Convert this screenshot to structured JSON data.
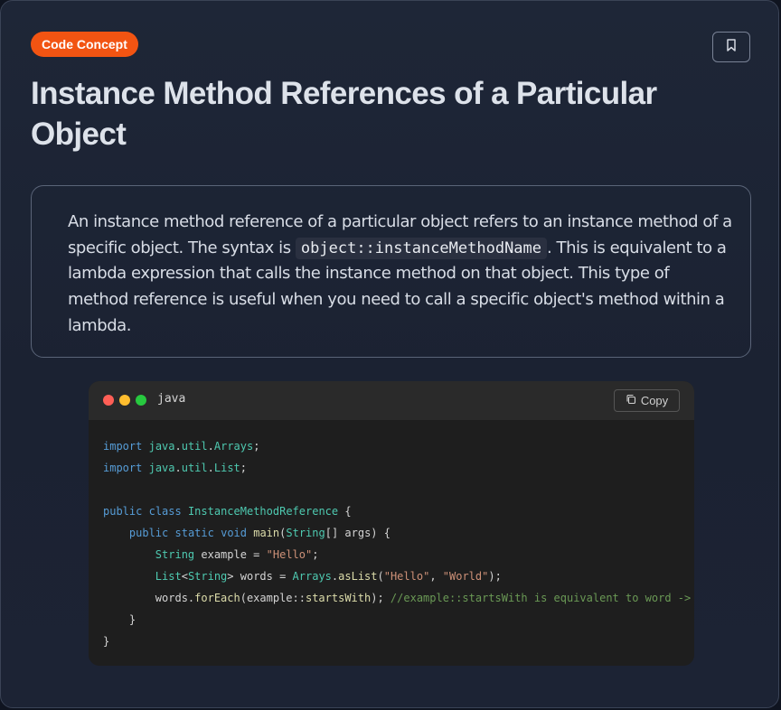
{
  "badge": "Code Concept",
  "title": "Instance Method References of a Particular Object",
  "description": {
    "before_code": "An instance method reference of a particular object refers to an instance method of a specific object. The syntax is ",
    "code": "object::instanceMethodName",
    "after_code": ". This is equivalent to a lambda expression that calls the instance method on that object. This type of method reference is useful when you need to call a specific object's method within a lambda."
  },
  "code_block": {
    "language": "java",
    "copy_label": "Copy",
    "lines": [
      [
        {
          "t": "import",
          "c": "kw"
        },
        {
          "t": " ",
          "c": "pl"
        },
        {
          "t": "java",
          "c": "ty"
        },
        {
          "t": ".",
          "c": "pl"
        },
        {
          "t": "util",
          "c": "ty"
        },
        {
          "t": ".",
          "c": "pl"
        },
        {
          "t": "Arrays",
          "c": "ty"
        },
        {
          "t": ";",
          "c": "pl"
        }
      ],
      [
        {
          "t": "import",
          "c": "kw"
        },
        {
          "t": " ",
          "c": "pl"
        },
        {
          "t": "java",
          "c": "ty"
        },
        {
          "t": ".",
          "c": "pl"
        },
        {
          "t": "util",
          "c": "ty"
        },
        {
          "t": ".",
          "c": "pl"
        },
        {
          "t": "List",
          "c": "ty"
        },
        {
          "t": ";",
          "c": "pl"
        }
      ],
      [],
      [
        {
          "t": "public",
          "c": "kw"
        },
        {
          "t": " ",
          "c": "pl"
        },
        {
          "t": "class",
          "c": "kw"
        },
        {
          "t": " ",
          "c": "pl"
        },
        {
          "t": "InstanceMethodReference",
          "c": "ty"
        },
        {
          "t": " {",
          "c": "pl"
        }
      ],
      [
        {
          "t": "    ",
          "c": "pl"
        },
        {
          "t": "public",
          "c": "kw"
        },
        {
          "t": " ",
          "c": "pl"
        },
        {
          "t": "static",
          "c": "kw"
        },
        {
          "t": " ",
          "c": "pl"
        },
        {
          "t": "void",
          "c": "kw"
        },
        {
          "t": " ",
          "c": "pl"
        },
        {
          "t": "main",
          "c": "fn"
        },
        {
          "t": "(",
          "c": "pl"
        },
        {
          "t": "String",
          "c": "ty"
        },
        {
          "t": "[] args) {",
          "c": "pl"
        }
      ],
      [
        {
          "t": "        ",
          "c": "pl"
        },
        {
          "t": "String",
          "c": "ty"
        },
        {
          "t": " example = ",
          "c": "pl"
        },
        {
          "t": "\"Hello\"",
          "c": "st"
        },
        {
          "t": ";",
          "c": "pl"
        }
      ],
      [
        {
          "t": "        ",
          "c": "pl"
        },
        {
          "t": "List",
          "c": "ty"
        },
        {
          "t": "<",
          "c": "pl"
        },
        {
          "t": "String",
          "c": "ty"
        },
        {
          "t": "> words = ",
          "c": "pl"
        },
        {
          "t": "Arrays",
          "c": "ty"
        },
        {
          "t": ".",
          "c": "pl"
        },
        {
          "t": "asList",
          "c": "fn"
        },
        {
          "t": "(",
          "c": "pl"
        },
        {
          "t": "\"Hello\"",
          "c": "st"
        },
        {
          "t": ", ",
          "c": "pl"
        },
        {
          "t": "\"World\"",
          "c": "st"
        },
        {
          "t": ");",
          "c": "pl"
        }
      ],
      [
        {
          "t": "        words.",
          "c": "pl"
        },
        {
          "t": "forEach",
          "c": "fn"
        },
        {
          "t": "(example::",
          "c": "pl"
        },
        {
          "t": "startsWith",
          "c": "fn"
        },
        {
          "t": "); ",
          "c": "pl"
        },
        {
          "t": "//example::startsWith is equivalent to word -> example.startsWith(word)",
          "c": "cm"
        }
      ],
      [
        {
          "t": "    }",
          "c": "pl"
        }
      ],
      [
        {
          "t": "}",
          "c": "pl"
        }
      ]
    ]
  }
}
